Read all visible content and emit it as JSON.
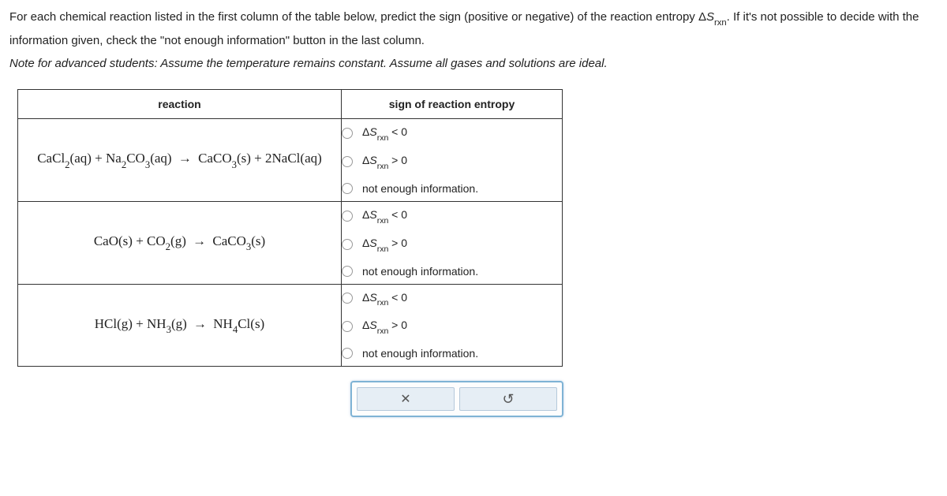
{
  "intro": {
    "part1": "For each chemical reaction listed in the first column of the table below, predict the sign (positive or negative) of the reaction entropy ",
    "deltaS_main": "Δ",
    "deltaS_S": "S",
    "deltaS_sub": "rxn",
    "part2": ". If it's not possible to decide with the information given, check the \"not enough information\" button in the last column.",
    "note_label": "Note for advanced students:",
    "note_text": " Assume the temperature remains constant. Assume all gases and solutions are ideal."
  },
  "headers": {
    "reaction": "reaction",
    "sign": "sign of reaction entropy"
  },
  "options": {
    "lt": " < 0",
    "gt": " > 0",
    "nei": "not enough information.",
    "ds_delta": "Δ",
    "ds_S": "S",
    "ds_sub": "rxn"
  },
  "reactions": {
    "r1": {
      "a": "CaCl",
      "a_sub": "2",
      "a_state": "(aq)",
      "plus1": " + ",
      "b": "Na",
      "b_sub": "2",
      "b2": "CO",
      "b2_sub": "3",
      "b_state": "(aq)",
      "arrow": "→",
      "c": "CaCO",
      "c_sub": "3",
      "c_state": "(s)",
      "plus2": " + ",
      "d_coef": "2",
      "d": "NaCl",
      "d_state": "(aq)"
    },
    "r2": {
      "a": "CaO",
      "a_state": "(s)",
      "plus1": " + ",
      "b": "CO",
      "b_sub": "2",
      "b_state": "(g)",
      "arrow": "→",
      "c": "CaCO",
      "c_sub": "3",
      "c_state": "(s)"
    },
    "r3": {
      "a": "HCl",
      "a_state": "(g)",
      "plus1": " + ",
      "b": "NH",
      "b_sub": "3",
      "b_state": "(g)",
      "arrow": "→",
      "c": "NH",
      "c_sub": "4",
      "c2": "Cl",
      "c_state": "(s)"
    }
  },
  "buttons": {
    "clear": "✕",
    "reset": "↺"
  }
}
